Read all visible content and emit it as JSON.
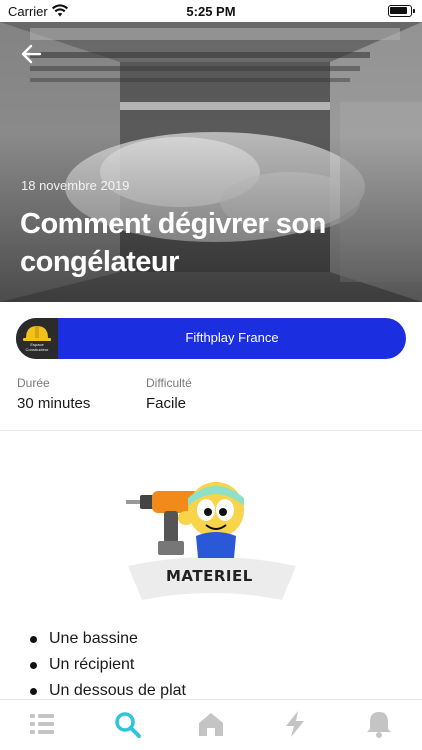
{
  "status_bar": {
    "carrier": "Carrier",
    "time": "5:25 PM"
  },
  "hero": {
    "date": "18 novembre 2019",
    "title": "Comment dégivrer son congélateur"
  },
  "author": {
    "name": "Fifthplay France",
    "logo_caption": "Espace Constructeur",
    "accent_color": "#1c2fe0"
  },
  "info": {
    "duration_label": "Durée",
    "duration_value": "30 minutes",
    "difficulty_label": "Difficulté",
    "difficulty_value": "Facile"
  },
  "illustration": {
    "label": "MATERIEL"
  },
  "materials": [
    "Une bassine",
    "Un récipient",
    "Un dessous de plat"
  ],
  "tabbar": {
    "items": [
      {
        "icon": "list-icon",
        "active": false
      },
      {
        "icon": "search-icon",
        "active": true
      },
      {
        "icon": "home-icon",
        "active": false
      },
      {
        "icon": "lightning-icon",
        "active": false
      },
      {
        "icon": "bell-icon",
        "active": false
      }
    ],
    "active_color": "#2ec4dc",
    "inactive_color": "#c4c4c4"
  }
}
